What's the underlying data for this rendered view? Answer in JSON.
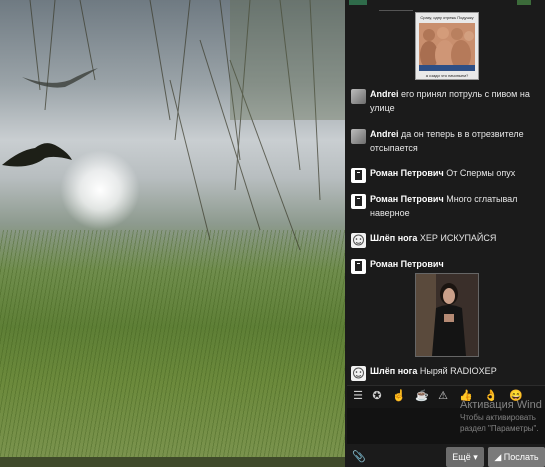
{
  "chat": {
    "messages": [
      {
        "author": "Andrei",
        "text": "его принял потруль с пивом на улице"
      },
      {
        "author": "Andrei",
        "text": "да он теперь в в отрезвителе отсыпается"
      },
      {
        "author": "Роман Петрович",
        "text": "От Спермы опух"
      },
      {
        "author": "Роман Петрович",
        "text": "Много сглатывал наверное"
      },
      {
        "author": "Шлёп нога",
        "text": "ХЕР ИСКУПАЙСЯ"
      },
      {
        "author": "Роман Петрович",
        "text": ""
      },
      {
        "author": "Шлёп нога",
        "text": "Ныряй RADIOXEP"
      }
    ],
    "image1_caption_top": "Сразу, одну отрежь Подушку",
    "image1_caption_bottom": "а сзади что начиньем?"
  },
  "emojis": [
    "☰",
    "✪",
    "☝",
    "☕",
    "⚠",
    "👍",
    "👌",
    "😄"
  ],
  "buttons": {
    "attach": "📎",
    "more": "Ещё ▾",
    "send": "◢ Послать"
  },
  "watermark": {
    "line1": "Активация Wind",
    "line2": "Чтобы активировать",
    "line3": "раздел \"Параметры\"."
  }
}
